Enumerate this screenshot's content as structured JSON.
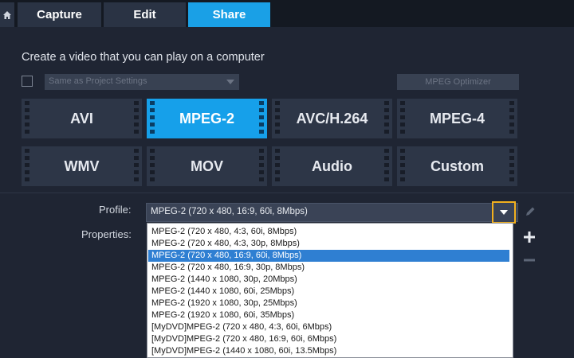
{
  "tabs": [
    {
      "label": "Capture",
      "active": false
    },
    {
      "label": "Edit",
      "active": false
    },
    {
      "label": "Share",
      "active": true
    }
  ],
  "heading": "Create a video that you can play on a computer",
  "project_settings": {
    "checked": false,
    "value": "Same as Project Settings"
  },
  "optimizer_label": "MPEG Optimizer",
  "formats": [
    {
      "label": "AVI",
      "active": false
    },
    {
      "label": "MPEG-2",
      "active": true
    },
    {
      "label": "AVC/H.264",
      "active": false
    },
    {
      "label": "MPEG-4",
      "active": false
    },
    {
      "label": "WMV",
      "active": false
    },
    {
      "label": "MOV",
      "active": false
    },
    {
      "label": "Audio",
      "active": false
    },
    {
      "label": "Custom",
      "active": false
    }
  ],
  "profile_label": "Profile:",
  "properties_label": "Properties:",
  "profile_value": "MPEG-2 (720 x 480, 16:9, 60i, 8Mbps)",
  "profile_options": [
    "MPEG-2 (720 x 480, 4:3, 60i, 8Mbps)",
    "MPEG-2 (720 x 480, 4:3, 30p, 8Mbps)",
    "MPEG-2 (720 x 480, 16:9, 60i, 8Mbps)",
    "MPEG-2 (720 x 480, 16:9, 30p, 8Mbps)",
    "MPEG-2 (1440 x 1080, 30p, 20Mbps)",
    "MPEG-2 (1440 x 1080, 60i, 25Mbps)",
    "MPEG-2 (1920 x 1080, 30p, 25Mbps)",
    "MPEG-2 (1920 x 1080, 60i, 35Mbps)",
    "[MyDVD]MPEG-2 (720 x 480, 4:3, 60i, 6Mbps)",
    "[MyDVD]MPEG-2 (720 x 480, 16:9, 60i, 6Mbps)",
    "[MyDVD]MPEG-2 (1440 x 1080, 60i, 13.5Mbps)"
  ],
  "selected_option_index": 2,
  "icons": {
    "home": "home-icon",
    "edit": "pencil-icon",
    "add": "plus-icon",
    "remove": "minus-icon",
    "dropdown": "chevron-down-icon"
  },
  "colors": {
    "accent": "#1aa0e6",
    "highlight_border": "#f2b01e",
    "selection": "#2f7fd2"
  }
}
